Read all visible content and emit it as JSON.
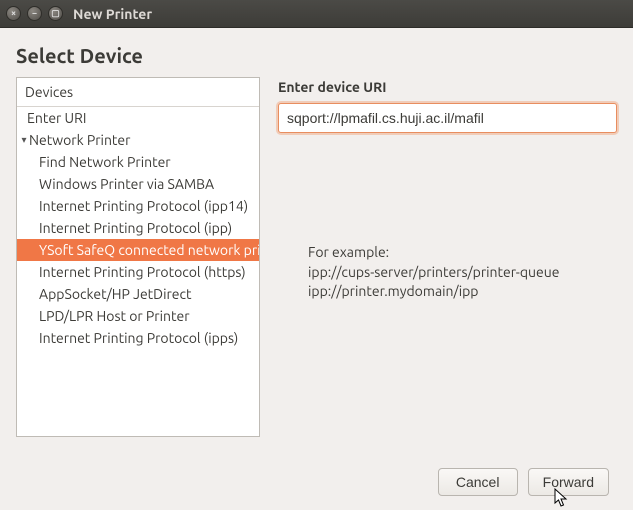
{
  "window": {
    "title": "New Printer"
  },
  "heading": "Select Device",
  "devices_header": "Devices",
  "device_tree": {
    "enter_uri": "Enter URI",
    "network_printer": "Network Printer",
    "children": {
      "find": "Find Network Printer",
      "samba": "Windows Printer via SAMBA",
      "ipp14": "Internet Printing Protocol (ipp14)",
      "ipp": "Internet Printing Protocol (ipp)",
      "ysoft": "YSoft SafeQ connected network printer",
      "https": "Internet Printing Protocol (https)",
      "appsocket": "AppSocket/HP JetDirect",
      "lpd": "LPD/LPR Host or Printer",
      "ipps": "Internet Printing Protocol (ipps)"
    }
  },
  "right": {
    "label": "Enter device URI",
    "uri_value": "sqport://lpmafil.cs.huji.ac.il/mafil",
    "example_heading": "For example:",
    "example_line1": "ipp://cups-server/printers/printer-queue",
    "example_line2": "ipp://printer.mydomain/ipp"
  },
  "buttons": {
    "cancel": "Cancel",
    "forward": "Forward"
  }
}
